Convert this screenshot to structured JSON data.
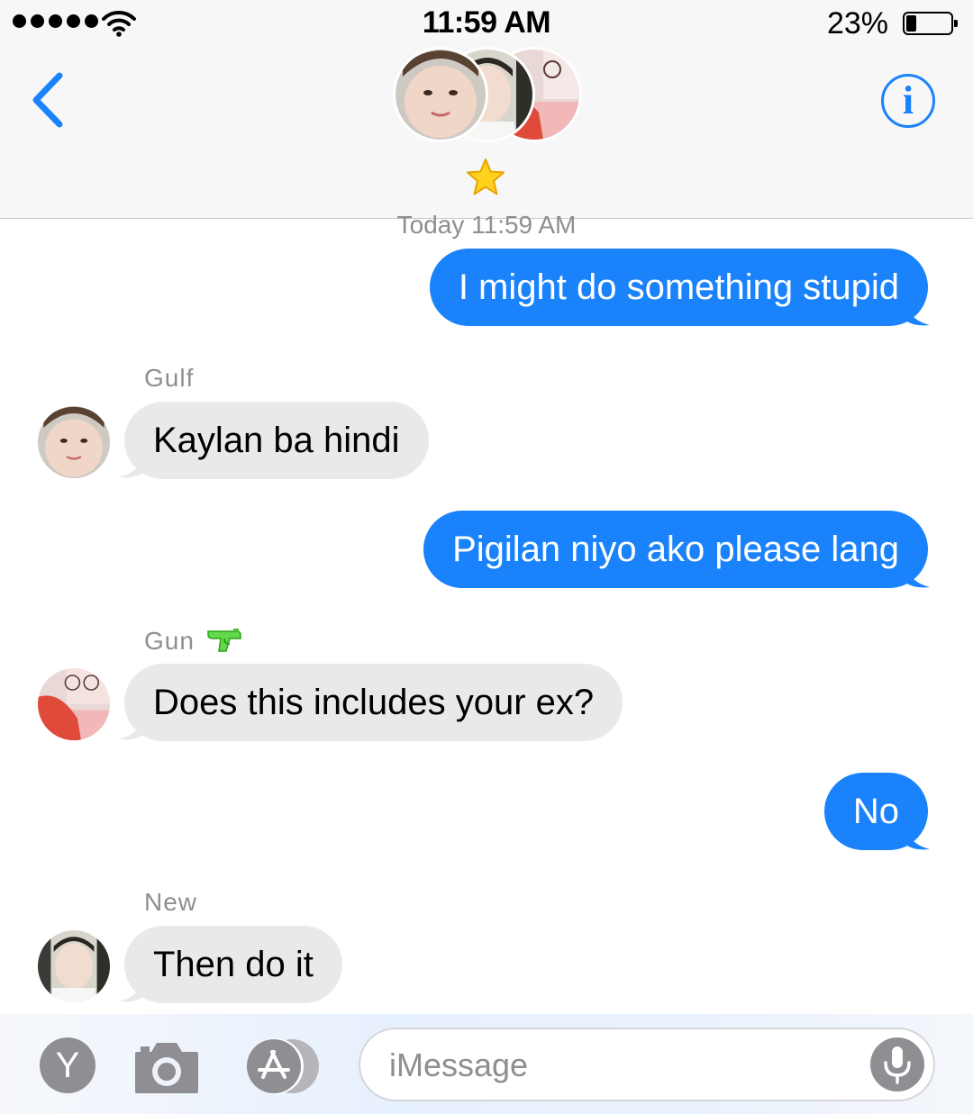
{
  "status_bar": {
    "time": "11:59 AM",
    "battery_percent": "23%",
    "battery_level": 0.23,
    "signal_bars": 5,
    "icons": [
      "signal-dots",
      "wifi-icon",
      "battery-icon"
    ]
  },
  "header": {
    "back_icon": "chevron-left-icon",
    "group_avatar_count": 3,
    "badge_icon": "star-icon",
    "info_icon": "info-icon"
  },
  "conversation": {
    "timestamp": "Today 11:59 AM",
    "messages": [
      {
        "direction": "outgoing",
        "text": "I might do something stupid"
      },
      {
        "direction": "incoming",
        "sender": "Gulf",
        "text": "Kaylan ba hindi"
      },
      {
        "direction": "outgoing",
        "text": "Pigilan niyo ako please lang"
      },
      {
        "direction": "incoming",
        "sender": "Gun",
        "sender_icon": "water-pistol-icon",
        "text": "Does this includes your ex?"
      },
      {
        "direction": "outgoing",
        "text": "No"
      },
      {
        "direction": "incoming",
        "sender": "New",
        "text": "Then do it"
      }
    ]
  },
  "input_bar": {
    "app_button_letter": "Y",
    "placeholder": "iMessage",
    "icons": [
      "camera-icon",
      "app-store-icon",
      "microphone-icon"
    ]
  },
  "colors": {
    "outgoing_bubble": "#1a82fb",
    "incoming_bubble": "#e9e9eb",
    "accent": "#1a82fb",
    "secondary_text": "#8e8e93"
  }
}
